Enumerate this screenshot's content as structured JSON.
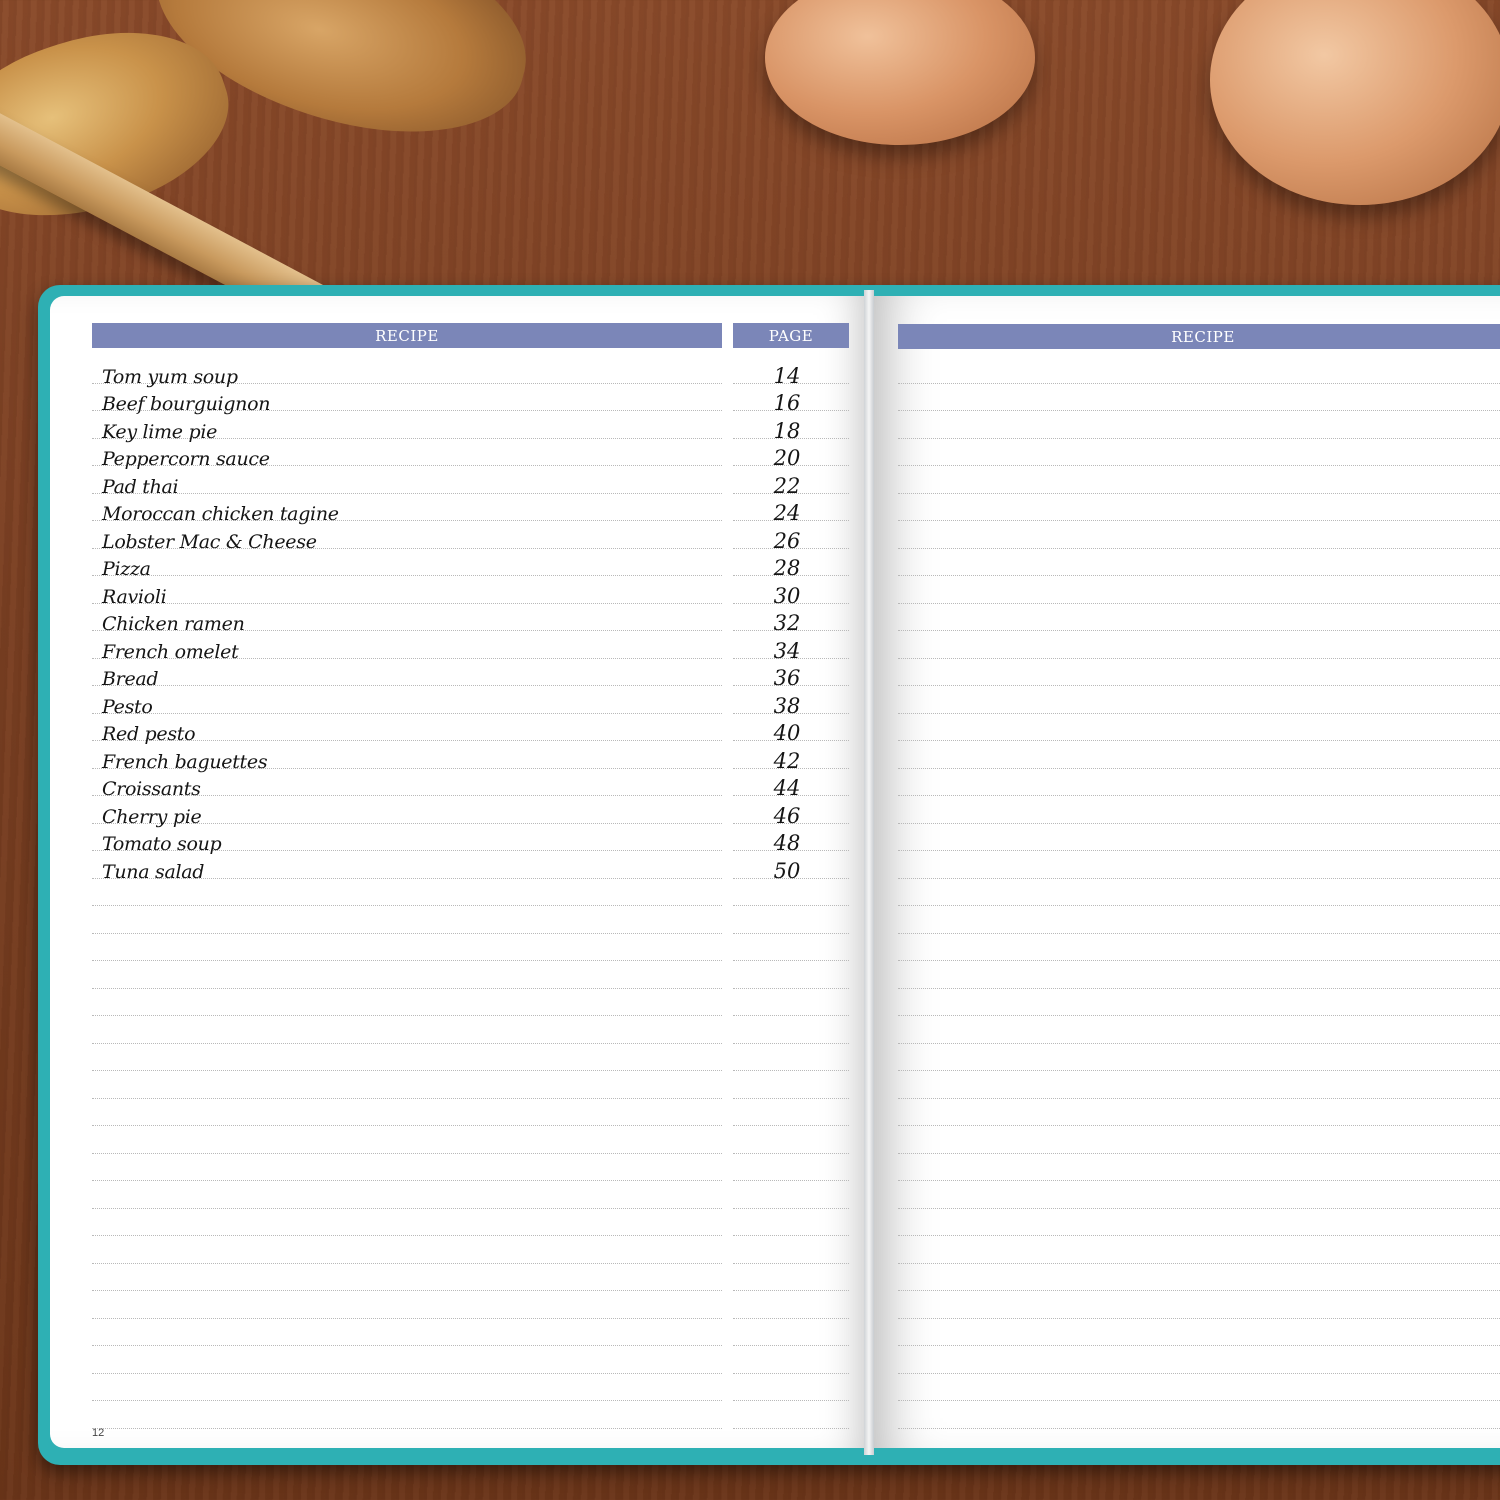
{
  "left_page": {
    "recipe_header": "RECIPE",
    "page_header": "PAGE",
    "entries": [
      {
        "recipe": "Tom yum soup",
        "page": "14"
      },
      {
        "recipe": "Beef bourguignon",
        "page": "16"
      },
      {
        "recipe": "Key lime pie",
        "page": "18"
      },
      {
        "recipe": "Peppercorn sauce",
        "page": "20"
      },
      {
        "recipe": "Pad thai",
        "page": "22"
      },
      {
        "recipe": "Moroccan chicken tagine",
        "page": "24"
      },
      {
        "recipe": "Lobster Mac & Cheese",
        "page": "26"
      },
      {
        "recipe": "Pizza",
        "page": "28"
      },
      {
        "recipe": "Ravioli",
        "page": "30"
      },
      {
        "recipe": "Chicken ramen",
        "page": "32"
      },
      {
        "recipe": "French omelet",
        "page": "34"
      },
      {
        "recipe": "Bread",
        "page": "36"
      },
      {
        "recipe": "Pesto",
        "page": "38"
      },
      {
        "recipe": "Red pesto",
        "page": "40"
      },
      {
        "recipe": "French baguettes",
        "page": "42"
      },
      {
        "recipe": "Croissants",
        "page": "44"
      },
      {
        "recipe": "Cherry pie",
        "page": "46"
      },
      {
        "recipe": "Tomato soup",
        "page": "48"
      },
      {
        "recipe": "Tuna salad",
        "page": "50"
      }
    ],
    "page_number": "12"
  },
  "right_page": {
    "recipe_header": "RECIPE"
  },
  "colors": {
    "header_bar": "#7b86b8",
    "cover": "#2eb0b4",
    "table": "#7a3f22"
  }
}
